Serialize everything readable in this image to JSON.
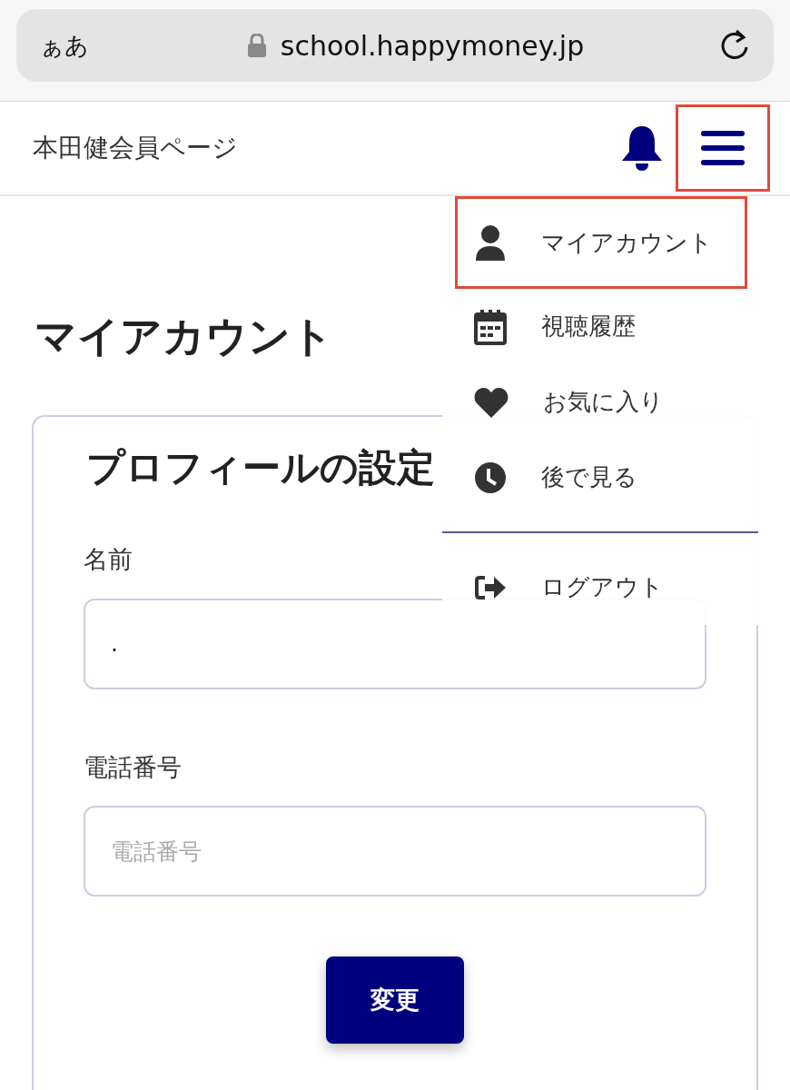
{
  "browser": {
    "text_size_button": "ぁあ",
    "url": "school.happymoney.jp"
  },
  "header": {
    "title": "本田健会員ページ",
    "menu_highlighted": true
  },
  "menu": {
    "items": [
      {
        "kind": "account",
        "label": "マイアカウント",
        "highlighted": true
      },
      {
        "kind": "history",
        "label": "視聴履歴",
        "highlighted": false
      },
      {
        "kind": "favorite",
        "label": "お気に入り",
        "highlighted": false
      },
      {
        "kind": "later",
        "label": "後で見る",
        "highlighted": false
      },
      {
        "kind": "logout",
        "label": "ログアウト",
        "highlighted": false
      }
    ]
  },
  "page_title": "マイアカウント",
  "card": {
    "title": "プロフィールの設定",
    "fields": [
      {
        "label": "名前",
        "value": "."
      },
      {
        "label": "電話番号",
        "placeholder": "電話番号"
      }
    ],
    "button": "変更"
  }
}
